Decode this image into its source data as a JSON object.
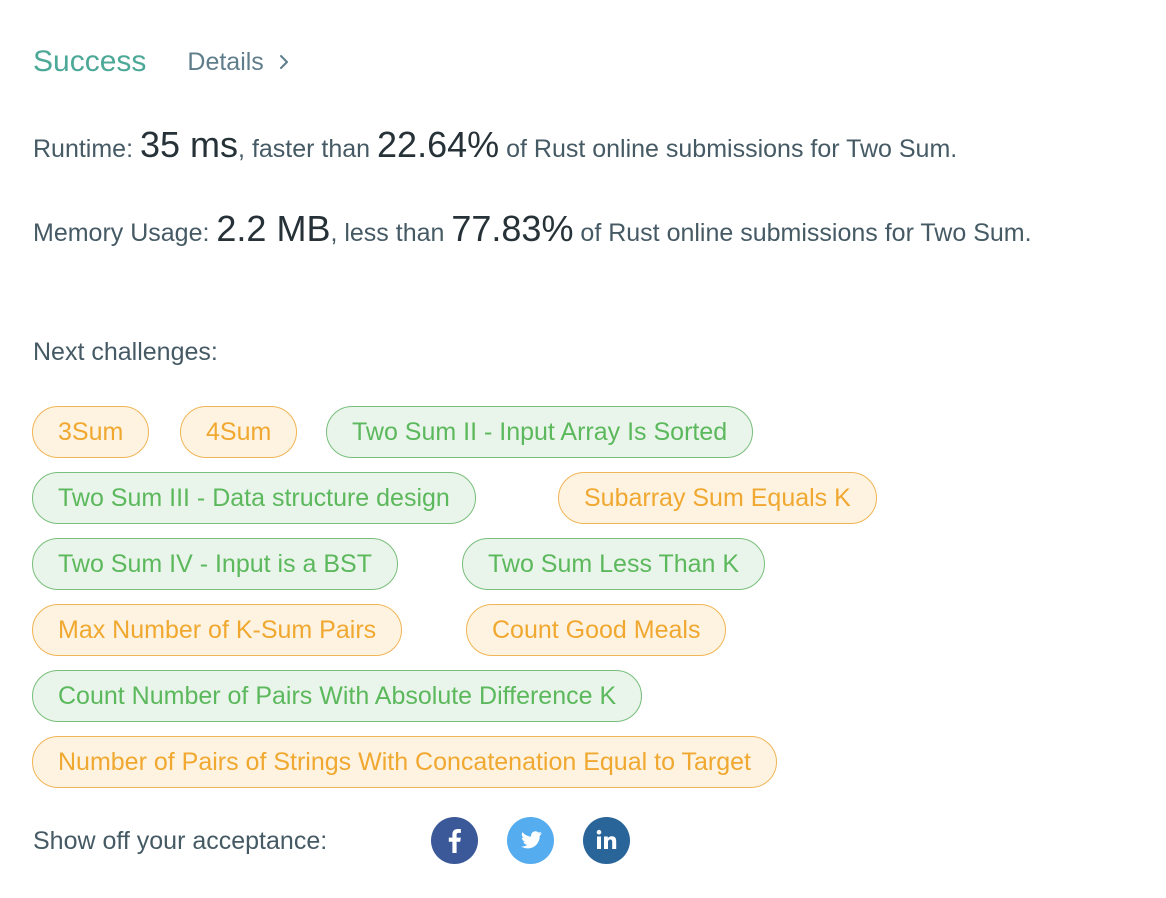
{
  "header": {
    "status": "Success",
    "details_label": "Details"
  },
  "runtime": {
    "label": "Runtime:",
    "value": "35 ms",
    "comparison": ", faster than",
    "percent": "22.64%",
    "suffix": "of Rust online submissions for Two Sum."
  },
  "memory": {
    "label": "Memory Usage:",
    "value": "2.2 MB",
    "comparison": ", less than",
    "percent": "77.83%",
    "suffix": "of Rust online submissions for Two Sum."
  },
  "next": {
    "label": "Next challenges:",
    "challenges": [
      {
        "label": "3Sum",
        "difficulty": "medium"
      },
      {
        "label": "4Sum",
        "difficulty": "medium"
      },
      {
        "label": "Two Sum II - Input Array Is Sorted",
        "difficulty": "easy"
      },
      {
        "label": "Two Sum III - Data structure design",
        "difficulty": "easy"
      },
      {
        "label": "Subarray Sum Equals K",
        "difficulty": "medium"
      },
      {
        "label": "Two Sum IV - Input is a BST",
        "difficulty": "easy"
      },
      {
        "label": "Two Sum Less Than K",
        "difficulty": "easy"
      },
      {
        "label": "Max Number of K-Sum Pairs",
        "difficulty": "medium"
      },
      {
        "label": "Count Good Meals",
        "difficulty": "medium"
      },
      {
        "label": "Count Number of Pairs With Absolute Difference K",
        "difficulty": "easy"
      },
      {
        "label": "Number of Pairs of Strings With Concatenation Equal to Target",
        "difficulty": "medium"
      }
    ]
  },
  "share": {
    "label": "Show off your acceptance:",
    "icons": [
      {
        "name": "facebook-icon",
        "color": "#3b5998"
      },
      {
        "name": "twitter-icon",
        "color": "#55acee"
      },
      {
        "name": "linkedin-icon",
        "color": "#2a6599"
      }
    ]
  },
  "colors": {
    "success": "#4ca897",
    "medium_text": "#f0a830",
    "medium_bg": "#fef3e1",
    "easy_text": "#5cb85c",
    "easy_bg": "#e9f5ea"
  }
}
